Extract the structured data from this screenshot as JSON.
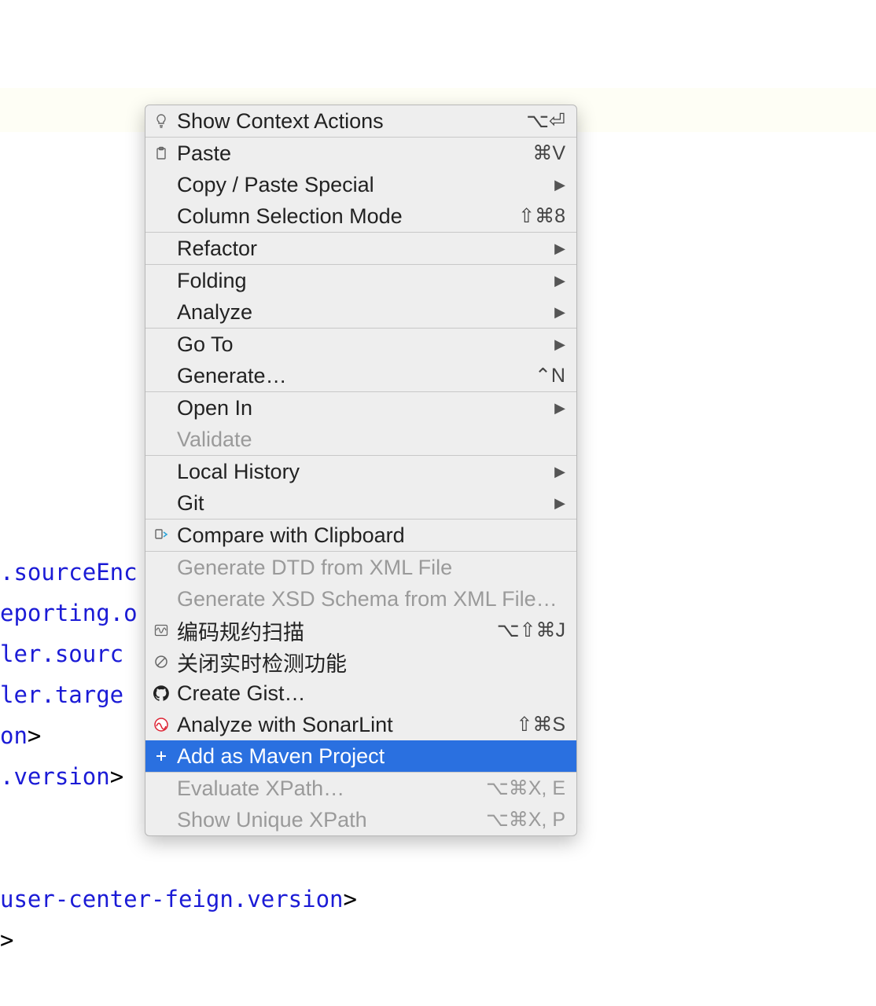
{
  "code_lines": {
    "l0": ".sourceEnc",
    "l1": "eporting.o",
    "l2": "ler.sourc",
    "l3": "ler.targe",
    "l4_tag": "on",
    "l5_tag": ".version",
    "l6_tag": "user-center-feign.version"
  },
  "menu": {
    "items": [
      {
        "icon": "lightbulb-icon",
        "label": "Show Context Actions",
        "shortcut": "⌥⏎"
      },
      "---",
      {
        "icon": "clipboard-icon",
        "label": "Paste",
        "shortcut": "⌘V"
      },
      {
        "label": "Copy / Paste Special",
        "submenu": true
      },
      {
        "label": "Column Selection Mode",
        "shortcut": "⇧⌘8"
      },
      "---",
      {
        "label": "Refactor",
        "submenu": true
      },
      "---",
      {
        "label": "Folding",
        "submenu": true
      },
      {
        "label": "Analyze",
        "submenu": true
      },
      "---",
      {
        "label": "Go To",
        "submenu": true
      },
      {
        "label": "Generate…",
        "shortcut": "⌃N"
      },
      "---",
      {
        "label": "Open In",
        "submenu": true
      },
      {
        "label": "Validate",
        "disabled": true
      },
      "---",
      {
        "label": "Local History",
        "submenu": true
      },
      {
        "label": "Git",
        "submenu": true
      },
      "---",
      {
        "icon": "compare-icon",
        "label": "Compare with Clipboard"
      },
      "---",
      {
        "label": "Generate DTD from XML File",
        "disabled": true
      },
      {
        "label": "Generate XSD Schema from XML File…",
        "disabled": true
      },
      {
        "icon": "waveform-icon",
        "label": "编码规约扫描",
        "shortcut": "⌥⇧⌘J"
      },
      {
        "icon": "prohibit-icon",
        "label": "关闭实时检测功能"
      },
      {
        "icon": "github-icon",
        "label": "Create Gist…"
      },
      {
        "icon": "sonar-icon",
        "label": "Analyze with SonarLint",
        "shortcut": "⇧⌘S"
      },
      {
        "icon": "plus-icon",
        "label": "Add as Maven Project",
        "selected": true
      },
      "---",
      {
        "label": "Evaluate XPath…",
        "shortcut": "⌥⌘X, E",
        "disabled": true
      },
      {
        "label": "Show Unique XPath",
        "shortcut": "⌥⌘X, P",
        "disabled": true
      }
    ]
  }
}
